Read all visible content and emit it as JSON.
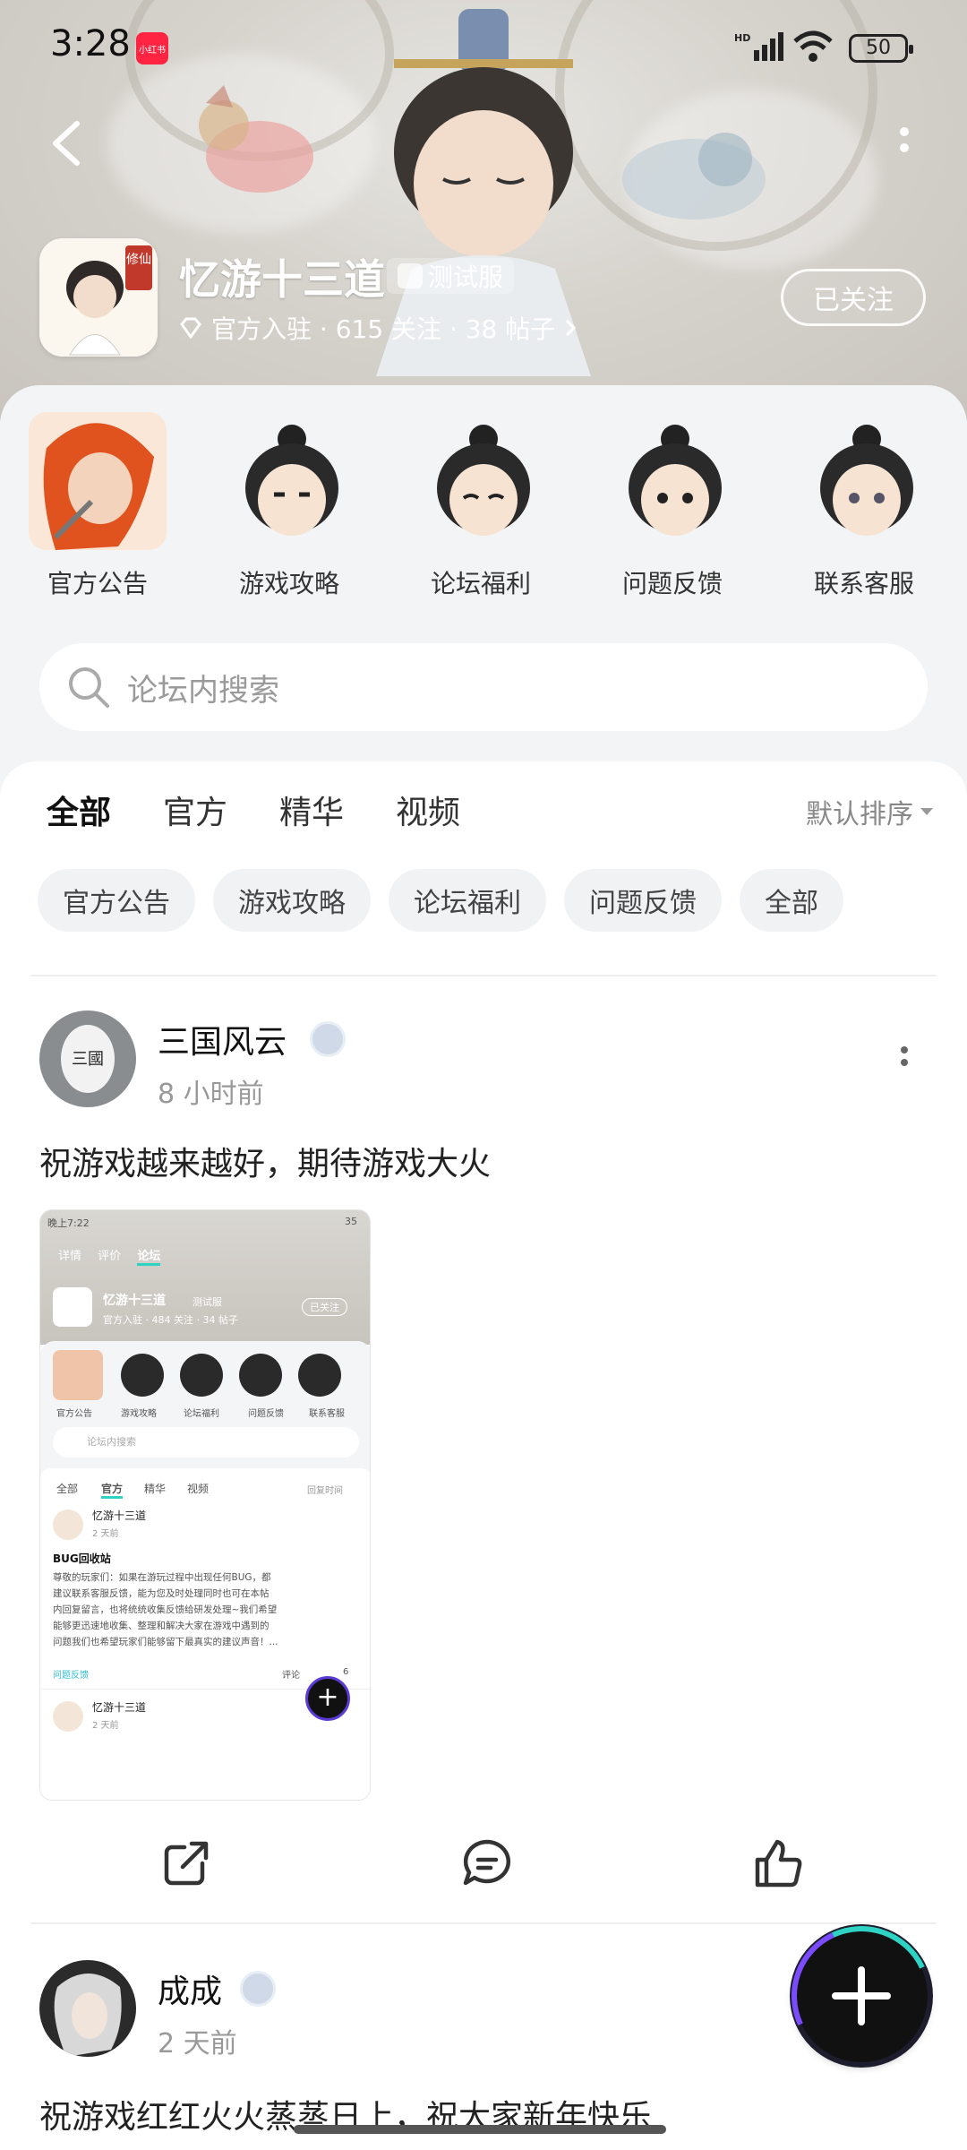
{
  "status_bar": {
    "time": "3:28",
    "app_badge": "小红书",
    "battery": "50"
  },
  "header": {
    "game_title": "忆游十三道",
    "test_tag": "测试服",
    "meta": "官方入驻 · 615 关注 · 38 帖子",
    "follow_label": "已关注",
    "icon_text": "修仙"
  },
  "categories": [
    {
      "label": "官方公告"
    },
    {
      "label": "游戏攻略"
    },
    {
      "label": "论坛福利"
    },
    {
      "label": "问题反馈"
    },
    {
      "label": "联系客服"
    }
  ],
  "search": {
    "placeholder": "论坛内搜索"
  },
  "tabs": [
    {
      "label": "全部",
      "active": true
    },
    {
      "label": "官方"
    },
    {
      "label": "精华"
    },
    {
      "label": "视频"
    }
  ],
  "sort_label": "默认排序",
  "chips": [
    "官方公告",
    "游戏攻略",
    "论坛福利",
    "问题反馈",
    "全部"
  ],
  "posts": [
    {
      "author": "三国风云",
      "time": "8 小时前",
      "text": "祝游戏越来越好，期待游戏大火",
      "screenshot": {
        "time": "晚上7:22",
        "battery": "35",
        "nav": [
          "详情",
          "评价",
          "论坛"
        ],
        "title": "忆游十三道",
        "test_tag": "测试服",
        "meta": "官方入驻 · 484 关注 · 34 帖子",
        "follow": "已关注",
        "cats": [
          "官方公告",
          "游戏攻略",
          "论坛福利",
          "问题反馈",
          "联系客服"
        ],
        "search": "论坛内搜索",
        "tabs": [
          "全部",
          "官方",
          "精华",
          "视频"
        ],
        "sort": "回复时间",
        "post_author": "忆游十三道",
        "post_time": "2 天前",
        "post_title": "BUG回收站",
        "post_body_1": "尊敬的玩家们：如果在游玩过程中出现任何BUG，都",
        "post_body_2": "建议联系客服反馈，能为您及时处理同时也可在本帖",
        "post_body_3": "内回复留言，也将统统收集反馈给研发处理~我们希望",
        "post_body_4": "能够更迅速地收集、整理和解决大家在游戏中遇到的",
        "post_body_5": "问题我们也希望玩家们能够留下最真实的建议声音！...",
        "post_tag": "问题反馈",
        "comment": "评论",
        "likes": "6",
        "post2_author": "忆游十三道",
        "post2_time": "2 天前"
      }
    },
    {
      "author": "成成",
      "time": "2 天前",
      "text": "祝游戏红红火火蒸蒸日上，祝大家新年快乐"
    }
  ]
}
